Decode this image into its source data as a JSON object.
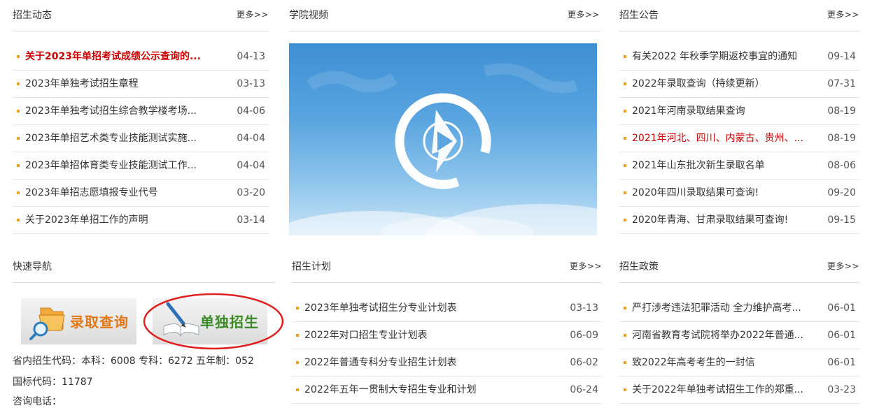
{
  "admission_news": {
    "title": "招生动态",
    "more": "更多>>",
    "items": [
      {
        "title": "关于2023年单招考试成绩公示查询的...",
        "date": "04-13"
      },
      {
        "title": "2023年单独考试招生章程",
        "date": "03-13"
      },
      {
        "title": "2023年单独考试招生综合教学楼考场...",
        "date": "04-06"
      },
      {
        "title": "2023年单招艺术类专业技能测试实施...",
        "date": "04-04"
      },
      {
        "title": "2023年单招体育类专业技能测试工作...",
        "date": "04-04"
      },
      {
        "title": "2023年单招志愿填报专业代号",
        "date": "03-20"
      },
      {
        "title": "关于2023年单招工作的声明",
        "date": "03-14"
      }
    ]
  },
  "college_video": {
    "title": "学院视频",
    "more": "更多>>"
  },
  "admission_notice": {
    "title": "招生公告",
    "more": "更多>>",
    "items": [
      {
        "title": "有关2022 年秋季学期返校事宜的通知",
        "date": "09-14"
      },
      {
        "title": "2022年录取查询（持续更新）",
        "date": "07-31"
      },
      {
        "title": "2021年河南录取结果查询",
        "date": "08-19"
      },
      {
        "title": "2021年河北、四川、内蒙古、贵州、...",
        "date": "08-19"
      },
      {
        "title": "2021年山东批次新生录取名单",
        "date": "08-06"
      },
      {
        "title": "2020年四川录取结果可查询!",
        "date": "09-20"
      },
      {
        "title": "2020年青海、甘肃录取结果可查询!",
        "date": "09-15"
      }
    ]
  },
  "quick_nav": {
    "title": "快速导航",
    "luqu_label": "录取查询",
    "danzhao_label": "单独招生",
    "code_line": "省内招生代码：本科：6008 专科：6272 五年制：052",
    "intl_code": "国标代码：11787",
    "phone_label": "咨询电话："
  },
  "admission_plan": {
    "title": "招生计划",
    "more": "更多>>",
    "items": [
      {
        "title": "2023年单独考试招生分专业计划表",
        "date": "03-13"
      },
      {
        "title": "2022年对口招生专业计划表",
        "date": "06-09"
      },
      {
        "title": "2022年普通专科分专业招生计划表",
        "date": "06-02"
      },
      {
        "title": "2022年五年一贯制大专招生专业和计划",
        "date": "06-24"
      }
    ]
  },
  "admission_policy": {
    "title": "招生政策",
    "more": "更多>>",
    "items": [
      {
        "title": "严打涉考违法犯罪活动 全力维护高考...",
        "date": "06-01"
      },
      {
        "title": "河南省教育考试院将举办2022年普通...",
        "date": "06-01"
      },
      {
        "title": "致2022年高考考生的一封信",
        "date": "06-01"
      },
      {
        "title": "关于2022年单独考试招生工作的郑重...",
        "date": "03-23"
      }
    ]
  },
  "colors": {
    "accent_red": "#cc0000",
    "bullet": "#f0a020",
    "annotation_circle": "#e02020"
  }
}
